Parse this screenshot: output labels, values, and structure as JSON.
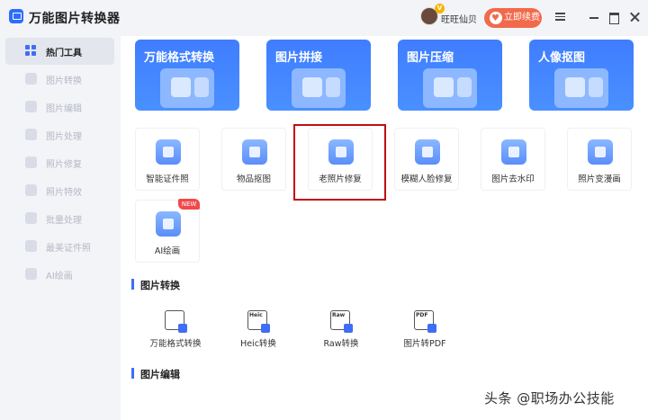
{
  "app": {
    "title": "万能图片转换器"
  },
  "user": {
    "name": "旺旺仙贝",
    "vip": "V"
  },
  "header": {
    "renew_label": "立即续费"
  },
  "sidebar": {
    "items": [
      {
        "label": "热门工具",
        "active": true
      },
      {
        "label": "图片转换"
      },
      {
        "label": "图片编辑"
      },
      {
        "label": "图片处理"
      },
      {
        "label": "照片修复"
      },
      {
        "label": "照片特效"
      },
      {
        "label": "批量处理"
      },
      {
        "label": "最美证件照"
      },
      {
        "label": "AI绘画"
      }
    ]
  },
  "banners": [
    {
      "label": "万能格式转换"
    },
    {
      "label": "图片拼接"
    },
    {
      "label": "图片压缩"
    },
    {
      "label": "人像抠图"
    }
  ],
  "tools": [
    {
      "label": "智能证件照",
      "icon": "id-card-icon"
    },
    {
      "label": "物品抠图",
      "icon": "shopping-bag-icon"
    },
    {
      "label": "老照片修复",
      "icon": "wrench-icon",
      "highlighted": true
    },
    {
      "label": "模糊人脸修复",
      "icon": "face-download-icon"
    },
    {
      "label": "图片去水印",
      "icon": "eraser-icon"
    },
    {
      "label": "照片变漫画",
      "icon": "bear-face-icon"
    },
    {
      "label": "AI绘画",
      "icon": "paint-board-icon",
      "badge": "NEW"
    }
  ],
  "sections": {
    "conversion": {
      "title": "图片转换",
      "items": [
        {
          "label": "万能格式转换",
          "tag": ""
        },
        {
          "label": "Heic转换",
          "tag": "Heic"
        },
        {
          "label": "Raw转换",
          "tag": "Raw"
        },
        {
          "label": "图片转PDF",
          "tag": "PDF"
        }
      ]
    },
    "editing": {
      "title": "图片编辑"
    }
  },
  "watermark": "头条 @职场办公技能",
  "colors": {
    "accent": "#3f6ef5",
    "renew": "#f26a4b",
    "highlight": "#c01010",
    "new_badge": "#f04a4a"
  }
}
